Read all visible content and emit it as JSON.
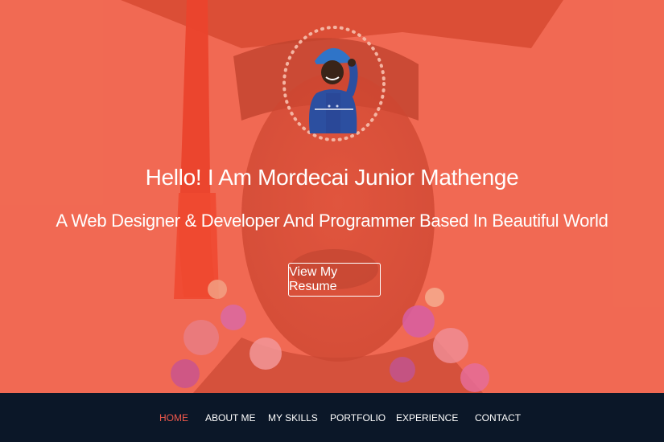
{
  "hero": {
    "title": "Hello! I Am Mordecai Junior Mathenge",
    "subtitle": "A Web Designer & Developer And Programmer Based In Beautiful World",
    "button_label": "View My Resume"
  },
  "nav": {
    "items": [
      {
        "label": "HOME",
        "active": true
      },
      {
        "label": "ABOUT ME",
        "active": false
      },
      {
        "label": "MY SKILLS",
        "active": false
      },
      {
        "label": "PORTFOLIO",
        "active": false
      },
      {
        "label": "EXPERIENCE",
        "active": false
      },
      {
        "label": "CONTACT",
        "active": false
      }
    ]
  },
  "colors": {
    "hero_overlay": "#f06a52",
    "nav_background": "#0b1728",
    "nav_active": "#f0584b",
    "text": "#ffffff"
  }
}
